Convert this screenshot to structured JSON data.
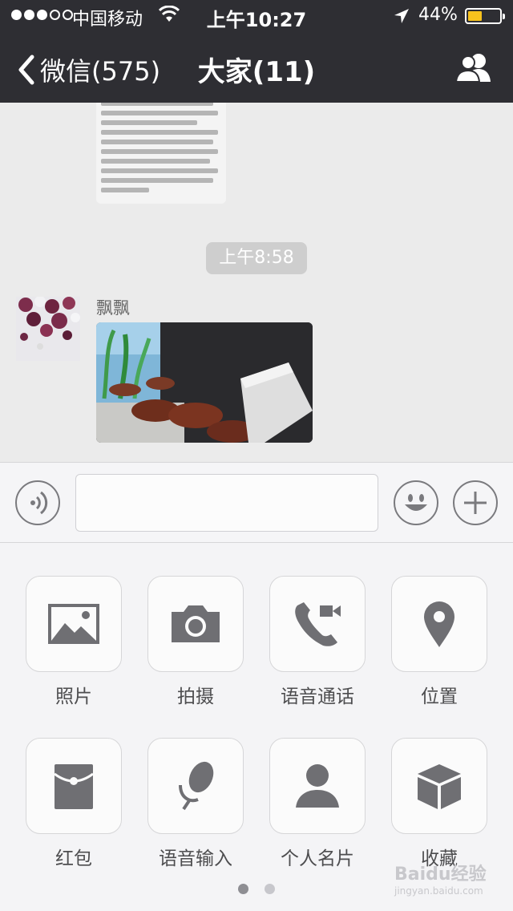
{
  "status_bar": {
    "carrier": "中国移动",
    "time": "上午10:27",
    "battery_percent": "44%",
    "battery_level": 0.44,
    "signal_bars_filled": 3,
    "signal_bars_total": 5
  },
  "nav": {
    "back_label": "微信(575)",
    "title": "大家(11)",
    "right_icon": "group-members-icon"
  },
  "chat": {
    "timestamp": "上午8:58",
    "message": {
      "sender": "飘飘",
      "type": "image"
    }
  },
  "input_bar": {
    "left_icon": "voice-mode-icon",
    "emoji_icon": "emoji-icon",
    "more_icon": "plus-icon",
    "text_value": ""
  },
  "panel": {
    "items": [
      {
        "label": "照片",
        "icon": "photo-icon"
      },
      {
        "label": "拍摄",
        "icon": "camera-icon"
      },
      {
        "label": "语音通话",
        "icon": "voice-call-icon"
      },
      {
        "label": "位置",
        "icon": "location-icon"
      },
      {
        "label": "红包",
        "icon": "red-packet-icon"
      },
      {
        "label": "语音输入",
        "icon": "microphone-icon"
      },
      {
        "label": "个人名片",
        "icon": "contact-card-icon"
      },
      {
        "label": "收藏",
        "icon": "favorites-icon"
      }
    ],
    "pages": 2,
    "current_page": 1
  },
  "watermark": {
    "text": "Baidu经验",
    "sub": "jingyan.baidu.com"
  },
  "colors": {
    "nav_bg": "#2e2e33",
    "battery": "#f7c21d",
    "icon_gray": "#6f6f73",
    "chat_bg": "#ebebeb"
  }
}
